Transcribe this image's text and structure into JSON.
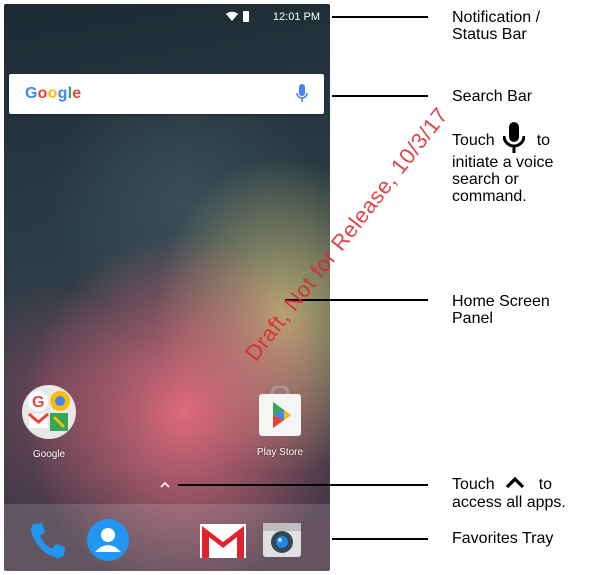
{
  "status_bar": {
    "time": "12:01 PM"
  },
  "search_bar": {
    "logo": [
      "G",
      "o",
      "o",
      "g",
      "l",
      "e"
    ]
  },
  "apps": {
    "google_folder": "Google",
    "play_store": "Play Store"
  },
  "callouts": {
    "status_bar": "Notification /\nStatus Bar",
    "search_bar": "Search Bar",
    "voice_touch": "Touch",
    "voice_to": "to",
    "voice_rest": "initiate a voice\nsearch or\ncommand.",
    "home_panel": "Home Screen\nPanel",
    "apps_touch": "Touch",
    "apps_to": "to",
    "apps_rest": "access all apps.",
    "favorites": "Favorites Tray"
  },
  "watermark": "Draft, Not for Release, 10/3/17",
  "colors": {
    "watermark": "#e0232d",
    "google_blue": "#4285f4",
    "google_red": "#ea4335",
    "google_yellow": "#fbbc05",
    "google_green": "#34a853"
  }
}
